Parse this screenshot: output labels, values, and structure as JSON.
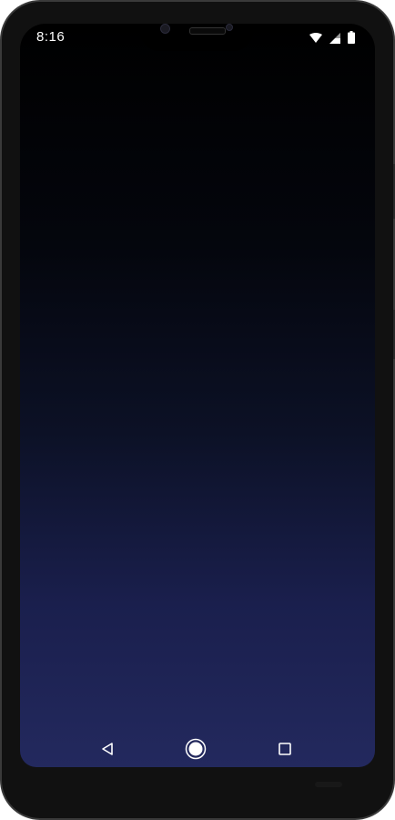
{
  "status_bar": {
    "time": "8:16",
    "icons": [
      "wifi-icon",
      "signal-icon",
      "battery-icon"
    ]
  },
  "navigation": {
    "back_icon": "back-triangle-icon",
    "home_icon": "home-circle-icon",
    "recents_icon": "recents-square-icon"
  },
  "colors": {
    "screen_top": "#000000",
    "screen_bottom": "#23295e",
    "icon": "#ffffff",
    "bezel": "#111111"
  }
}
